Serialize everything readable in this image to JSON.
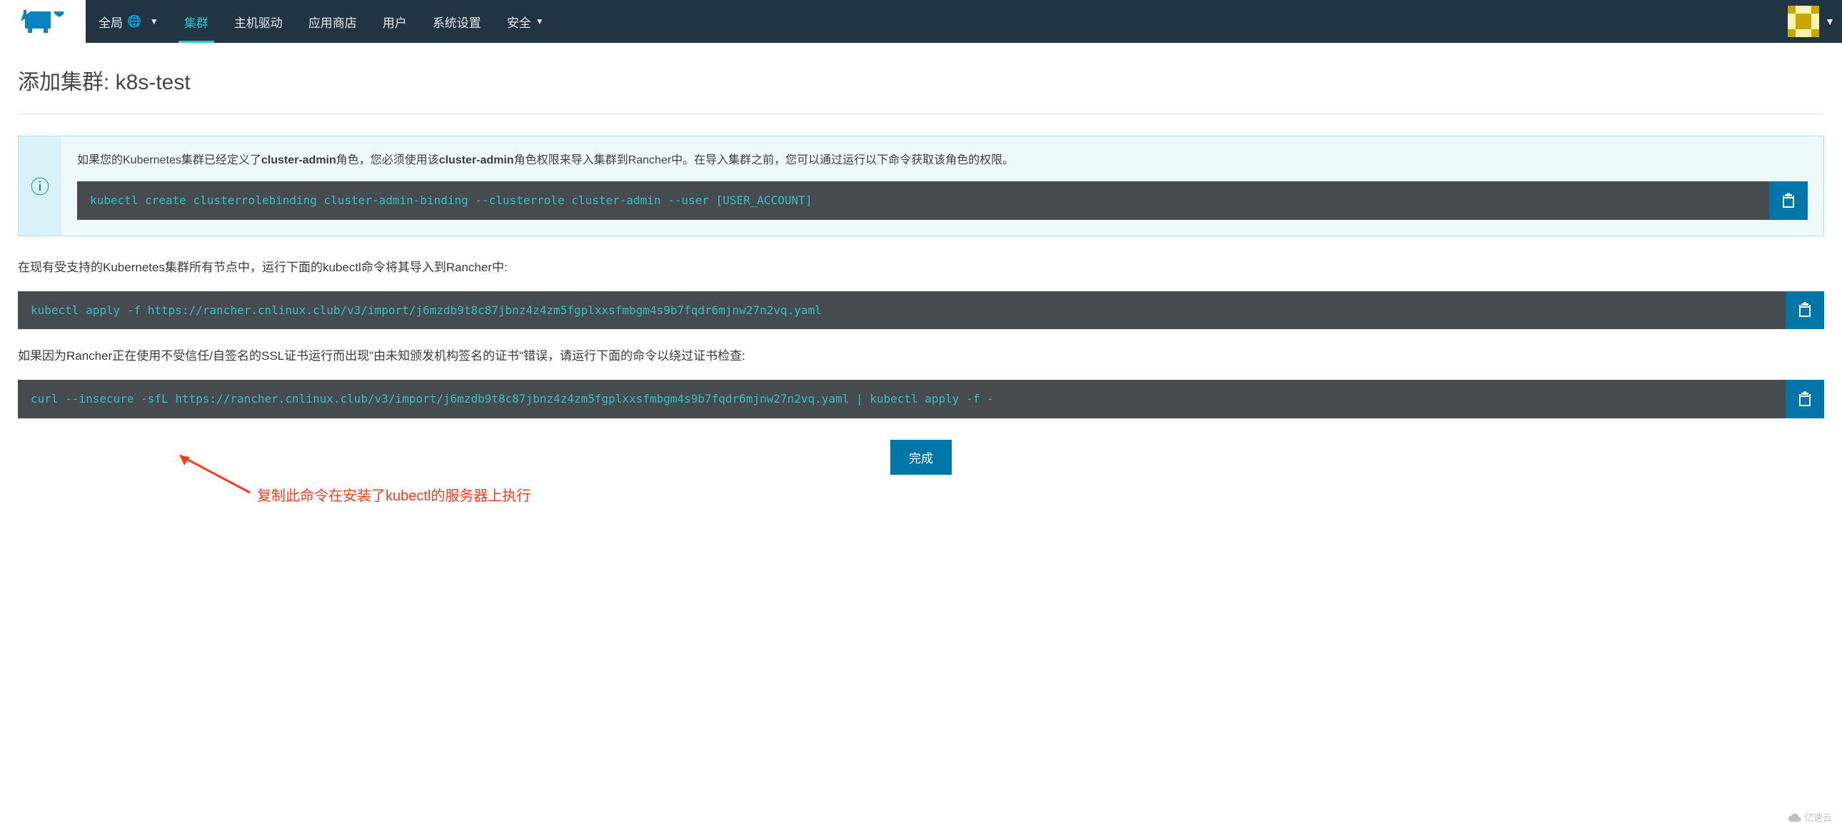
{
  "nav": {
    "global_label": "全局",
    "items": [
      "集群",
      "主机驱动",
      "应用商店",
      "用户",
      "系统设置",
      "安全"
    ],
    "active_index": 0,
    "dropdown_indices": [
      5
    ]
  },
  "page": {
    "title_prefix": "添加集群: ",
    "cluster_name": "k8s-test"
  },
  "info_banner": {
    "text_before_bold1": "如果您的Kubernetes集群已经定义了",
    "bold1": "cluster-admin",
    "text_mid": "角色，您必须使用该",
    "bold2": "cluster-admin",
    "text_after_bold2": "角色权限来导入集群到Rancher中。在导入集群之前，您可以通过运行以下命令获取该角色的权限。",
    "command": "kubectl create clusterrolebinding cluster-admin-binding --clusterrole cluster-admin --user [USER_ACCOUNT]"
  },
  "section1": {
    "text": "在现有受支持的Kubernetes集群所有节点中，运行下面的kubectl命令将其导入到Rancher中:",
    "command": "kubectl apply -f https://rancher.cnlinux.club/v3/import/j6mzdb9t8c87jbnz4z4zm5fgplxxsfmbgm4s9b7fqdr6mjnw27n2vq.yaml"
  },
  "section2": {
    "text": "如果因为Rancher正在使用不受信任/自签名的SSL证书运行而出现\"由未知颁发机构签名的证书\"错误，请运行下面的命令以绕过证书检查:",
    "command": "curl --insecure -sfL https://rancher.cnlinux.club/v3/import/j6mzdb9t8c87jbnz4z4zm5fgplxxsfmbgm4s9b7fqdr6mjnw27n2vq.yaml | kubectl apply -f -"
  },
  "annotation": "复制此命令在安装了kubectl的服务器上执行",
  "buttons": {
    "done": "完成"
  },
  "watermark": "亿速云"
}
